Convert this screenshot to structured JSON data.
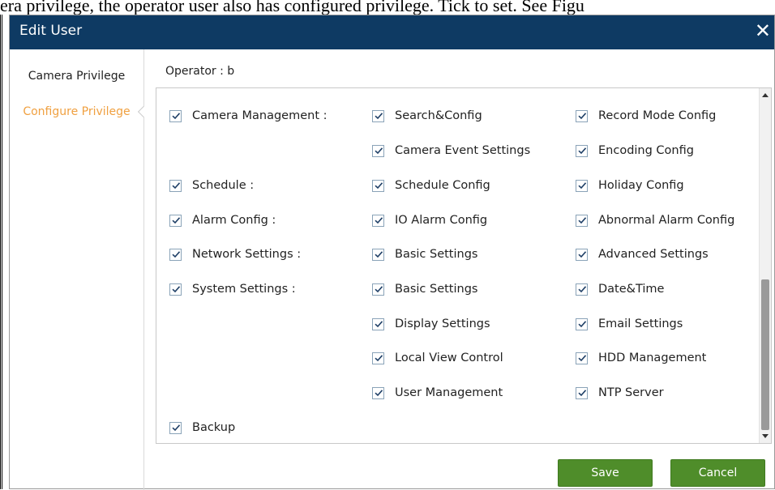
{
  "background_text": "era privilege, the operator user also has configured privilege. Tick to set. See Figu",
  "dialog": {
    "title": "Edit User",
    "close_symbol": "✕"
  },
  "sidebar": {
    "items": [
      {
        "label": "Camera Privilege",
        "active": false
      },
      {
        "label": "Configure Privilege",
        "active": true
      }
    ]
  },
  "operator": "Operator : b",
  "privileges": {
    "camera_management": "Camera Management :",
    "search_config": "Search&Config",
    "record_mode_config": "Record Mode Config",
    "camera_event_settings": "Camera Event Settings",
    "encoding_config": "Encoding Config",
    "schedule": "Schedule :",
    "schedule_config": "Schedule Config",
    "holiday_config": "Holiday Config",
    "alarm_config": "Alarm Config :",
    "io_alarm_config": "IO Alarm Config",
    "abnormal_alarm_config": "Abnormal Alarm Config",
    "network_settings": "Network Settings :",
    "net_basic_settings": "Basic Settings",
    "advanced_settings": "Advanced Settings",
    "system_settings": "System Settings :",
    "sys_basic_settings": "Basic Settings",
    "date_time": "Date&Time",
    "display_settings": "Display Settings",
    "email_settings": "Email Settings",
    "local_view_control": "Local View Control",
    "hdd_management": "HDD Management",
    "user_management": "User Management",
    "ntp_server": "NTP Server",
    "backup": "Backup"
  },
  "buttons": {
    "save": "Save",
    "cancel": "Cancel"
  },
  "colors": {
    "titlebar": "#0e3a63",
    "active_nav": "#f0a040",
    "button_green": "#4f8d2a"
  }
}
